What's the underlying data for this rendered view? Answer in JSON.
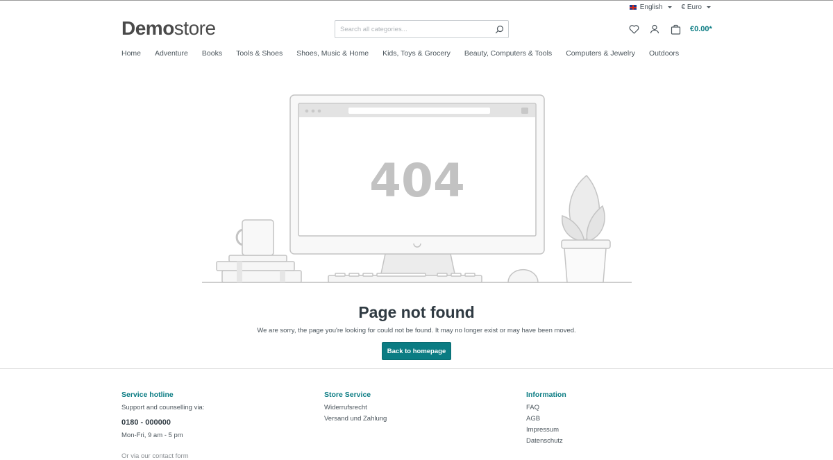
{
  "header": {
    "language": "English",
    "currency": "€ Euro",
    "logo_bold": "Demo",
    "logo_light": "store",
    "search_placeholder": "Search all categories...",
    "cart_total": "€0.00*",
    "icons": {
      "wishlist": "heart-icon",
      "account": "user-icon",
      "cart": "shopping-bag-icon",
      "search": "search-icon",
      "flag": "uk-flag-icon"
    }
  },
  "nav": {
    "items": [
      {
        "label": "Home"
      },
      {
        "label": "Adventure"
      },
      {
        "label": "Books"
      },
      {
        "label": "Tools & Shoes"
      },
      {
        "label": "Shoes, Music & Home"
      },
      {
        "label": "Kids, Toys & Grocery"
      },
      {
        "label": "Beauty, Computers & Tools"
      },
      {
        "label": "Computers & Jewelry"
      },
      {
        "label": "Outdoors"
      }
    ]
  },
  "error": {
    "code": "404",
    "title": "Page not found",
    "message": "We are sorry, the page you're looking for could not be found. It may no longer exist or may have been moved.",
    "button_label": "Back to homepage"
  },
  "footer": {
    "hotline": {
      "heading": "Service hotline",
      "intro": "Support and counselling via:",
      "phone": "0180 - 000000",
      "hours": "Mon-Fri, 9 am - 5 pm",
      "more": "Or via our contact form"
    },
    "store_service": {
      "heading": "Store Service",
      "links": [
        {
          "label": "Widerrufsrecht"
        },
        {
          "label": "Versand und Zahlung"
        }
      ]
    },
    "information": {
      "heading": "Information",
      "links": [
        {
          "label": "FAQ"
        },
        {
          "label": "AGB"
        },
        {
          "label": "Impressum"
        },
        {
          "label": "Datenschutz"
        }
      ]
    }
  },
  "colors": {
    "accent": "#0b7c83",
    "text": "#4a545b",
    "heading": "#2f3a42",
    "illustration_stroke": "#c8c8c8"
  }
}
